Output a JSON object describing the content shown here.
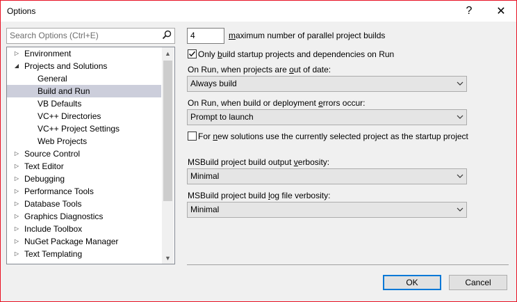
{
  "window": {
    "title": "Options"
  },
  "titlebar": {
    "help_glyph": "?",
    "close_glyph": "✕"
  },
  "search": {
    "placeholder": "Search Options (Ctrl+E)",
    "value": ""
  },
  "tree": {
    "items": [
      {
        "label": "Environment",
        "expand_glyph": "▷"
      },
      {
        "label": "Projects and Solutions",
        "expand_glyph": "◢"
      },
      {
        "label": "General"
      },
      {
        "label": "Build and Run"
      },
      {
        "label": "VB Defaults"
      },
      {
        "label": "VC++ Directories"
      },
      {
        "label": "VC++ Project Settings"
      },
      {
        "label": "Web Projects"
      },
      {
        "label": "Source Control",
        "expand_glyph": "▷"
      },
      {
        "label": "Text Editor",
        "expand_glyph": "▷"
      },
      {
        "label": "Debugging",
        "expand_glyph": "▷"
      },
      {
        "label": "Performance Tools",
        "expand_glyph": "▷"
      },
      {
        "label": "Database Tools",
        "expand_glyph": "▷"
      },
      {
        "label": "Graphics Diagnostics",
        "expand_glyph": "▷"
      },
      {
        "label": "Include Toolbox",
        "expand_glyph": "▷"
      },
      {
        "label": "NuGet Package Manager",
        "expand_glyph": "▷"
      },
      {
        "label": "Text Templating",
        "expand_glyph": "▷"
      }
    ],
    "selected": "Build and Run",
    "scroll_up_glyph": "▲",
    "scroll_down_glyph": "▼"
  },
  "settings": {
    "parallel_builds": {
      "value": "4",
      "label_pre": "",
      "label_mnemonic": "m",
      "label_post": "aximum number of parallel project builds"
    },
    "only_build_startup": {
      "checked": true,
      "label_pre": "Only ",
      "label_mnemonic": "b",
      "label_post": "uild startup projects and dependencies on Run"
    },
    "out_of_date": {
      "label_pre": "On Run, when projects are ",
      "label_mnemonic": "o",
      "label_post": "ut of date:",
      "selected": "Always build"
    },
    "build_errors": {
      "label_pre": "On Run, when build or deployment ",
      "label_mnemonic": "e",
      "label_post": "rrors occur:",
      "selected": "Prompt to launch"
    },
    "new_solutions": {
      "checked": false,
      "label_pre": "For ",
      "label_mnemonic": "n",
      "label_post": "ew solutions use the currently selected project as the startup project"
    },
    "output_verbosity": {
      "label_pre": "MSBuild project build output ",
      "label_mnemonic": "v",
      "label_post": "erbosity:",
      "selected": "Minimal"
    },
    "log_verbosity": {
      "label_pre": "MSBuild project build ",
      "label_mnemonic": "l",
      "label_post": "og file verbosity:",
      "selected": "Minimal"
    }
  },
  "footer": {
    "ok_label": "OK",
    "cancel_label": "Cancel"
  },
  "colors": {
    "selection": "#cccedb",
    "default_button_border": "#0078d7",
    "window_border": "#e81123"
  }
}
